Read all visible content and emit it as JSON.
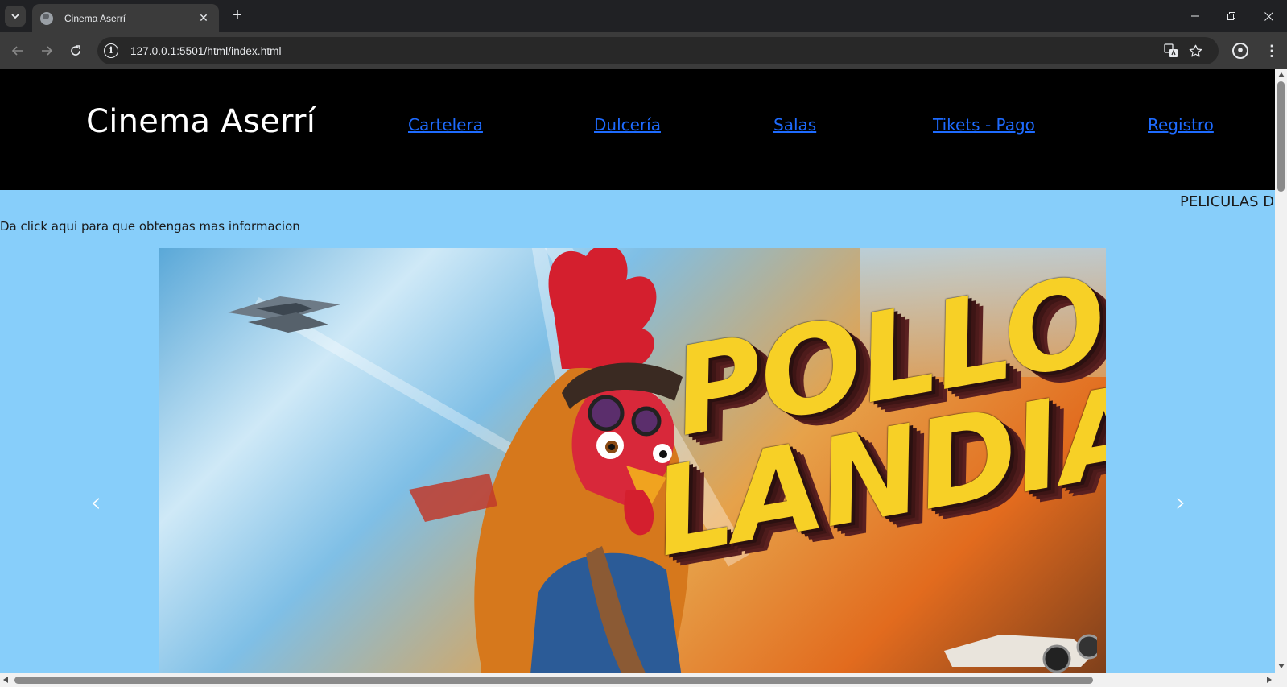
{
  "browser": {
    "tab_title": "Cinema Aserrí",
    "url": "127.0.0.1:5501/html/index.html",
    "new_tab_label": "+",
    "close_tab_label": "✕"
  },
  "site": {
    "title": "Cinema Aserrí",
    "nav": [
      "Cartelera",
      "Dulcería",
      "Salas",
      "Tikets - Pago",
      "Registro"
    ],
    "marquee": "PELICULAS D",
    "info_text": "Da click aqui para que obtengas mas informacion"
  },
  "carousel": {
    "slide_title_line1": "POLLO",
    "slide_title_line2": "LANDIA",
    "prev_label": "‹",
    "next_label": "›"
  },
  "colors": {
    "page_background": "#87cefa",
    "header_background": "#000000",
    "nav_link": "#1e6bff",
    "poster_title": "#f7d026"
  },
  "icons": {
    "tab_search": "chevron-down-icon",
    "favicon": "globe-icon",
    "back": "arrow-left-icon",
    "forward": "arrow-right-icon",
    "reload": "reload-icon",
    "info": "info-icon",
    "translate": "translate-icon",
    "bookmark": "star-icon",
    "profile": "profile-icon",
    "menu": "kebab-menu-icon"
  }
}
